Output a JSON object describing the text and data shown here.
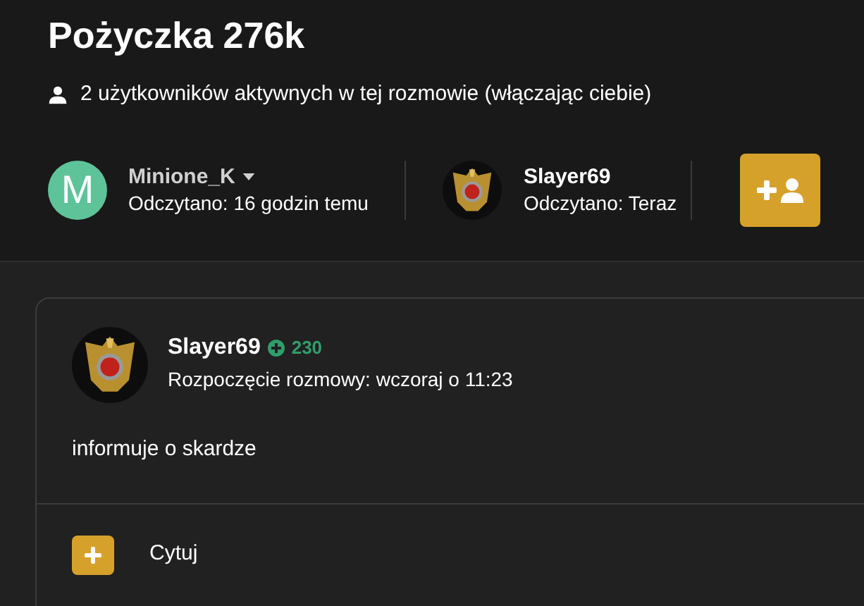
{
  "title": "Pożyczka 276k",
  "active_users": "2 użytkowników aktywnych w tej rozmowie (włączając ciebie)",
  "participants": [
    {
      "kind": "letter",
      "letter": "M",
      "name": "Minione_K",
      "has_menu": true,
      "read": "Odczytano: 16 godzin temu"
    },
    {
      "kind": "emblem",
      "name": "Slayer69",
      "has_menu": false,
      "read": "Odczytano: Teraz"
    }
  ],
  "message": {
    "author": "Slayer69",
    "reputation": "230",
    "started": "Rozpoczęcie rozmowy: wczoraj o 11:23",
    "body": "informuje o skardze",
    "actions": [
      {
        "label": "Cytuj"
      }
    ]
  }
}
